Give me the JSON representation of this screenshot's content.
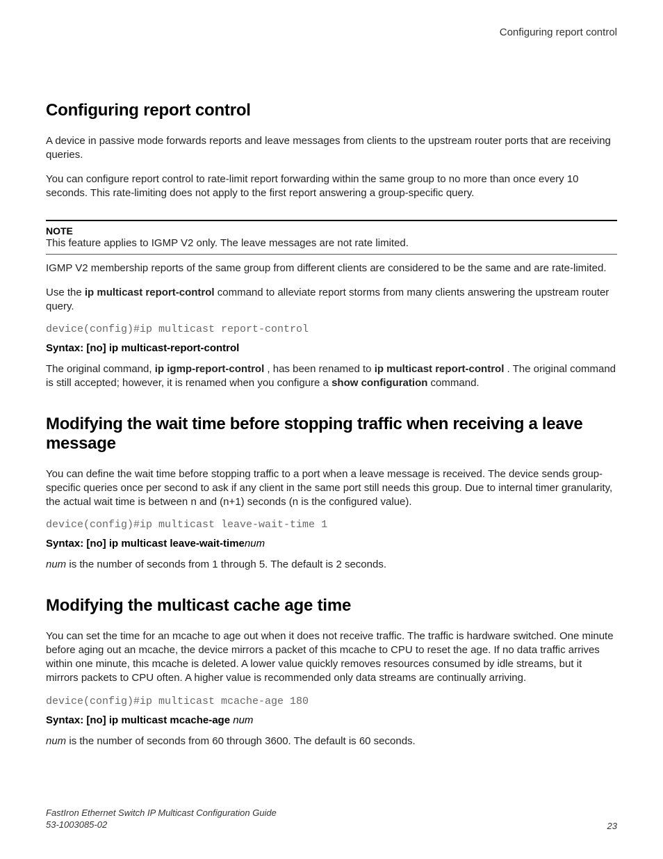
{
  "header": {
    "right": "Configuring report control"
  },
  "s1": {
    "title": "Configuring report control",
    "p1": "A device in passive mode forwards reports and leave messages from clients to the upstream router ports that are receiving queries.",
    "p2": "You can configure report control to rate-limit report forwarding within the same group to no more than once every 10 seconds. This rate-limiting does not apply to the first report answering a group-specific query.",
    "note_label": "NOTE",
    "note_text": "This feature applies to IGMP V2 only. The leave messages are not rate limited.",
    "p3": "IGMP V2 membership reports of the same group from different clients are considered to be the same and are rate-limited.",
    "p4a": "Use the ",
    "p4b": "ip multicast report-control",
    "p4c": " command to alleviate report storms from many clients answering the upstream router query.",
    "code": "device(config)#ip multicast report-control",
    "syntax": "Syntax: [no] ip multicast-report-control",
    "p5a": "The original command, ",
    "p5b": "ip igmp-report-control",
    "p5c": " , has been renamed to ",
    "p5d": "ip multicast report-control",
    "p5e": " . The original command is still accepted; however, it is renamed when you configure a ",
    "p5f": "show configuration",
    "p5g": " command."
  },
  "s2": {
    "title": "Modifying the wait time before stopping traffic when receiving a leave message",
    "p1": "You can define the wait time before stopping traffic to a port when a leave message is received. The device sends group-specific queries once per second to ask if any client in the same port still needs this group. Due to internal timer granularity, the actual wait time is between n and (n+1) seconds (n is the configured value).",
    "code": "device(config)#ip multicast leave-wait-time 1",
    "syntax_a": "Syntax: [no] ip multicast leave-wait-time",
    "syntax_b": "num",
    "p2a": "num",
    "p2b": " is the number of seconds from 1 through 5. The default is 2 seconds."
  },
  "s3": {
    "title": "Modifying the multicast cache age time",
    "p1": "You can set the time for an mcache to age out when it does not receive traffic. The traffic is hardware switched. One minute before aging out an mcache, the device mirrors a packet of this mcache to CPU to reset the age. If no data traffic arrives within one minute, this mcache is deleted. A lower value quickly removes resources consumed by idle streams, but it mirrors packets to CPU often. A higher value is recommended only data streams are continually arriving.",
    "code": "device(config)#ip multicast mcache-age 180",
    "syntax_a": "Syntax: [no] ip multicast mcache-age ",
    "syntax_b": "num",
    "p2a": "num",
    "p2b": " is the number of seconds from 60 through 3600. The default is 60 seconds."
  },
  "footer": {
    "title": "FastIron Ethernet Switch IP Multicast Configuration Guide",
    "doc": "53-1003085-02",
    "page": "23"
  }
}
